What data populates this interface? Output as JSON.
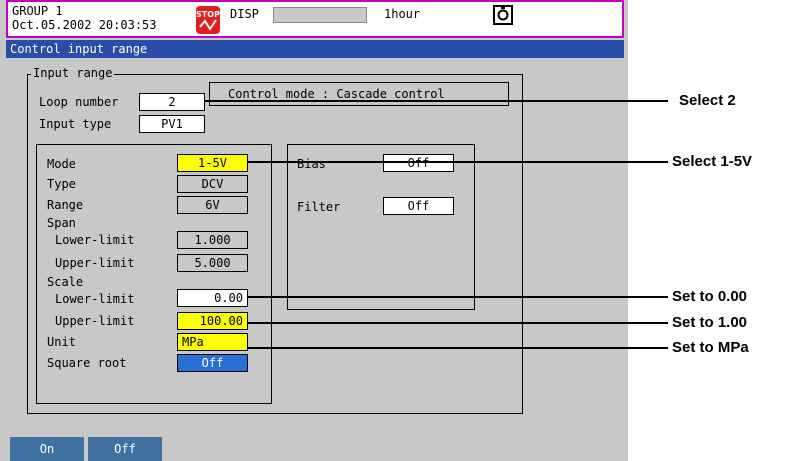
{
  "status": {
    "group": "GROUP 1",
    "datetime": "Oct.05.2002 20:03:53",
    "stop_icon": "stop-icon",
    "disp": "DISP",
    "interval": "1hour",
    "disk_icon": "disk-icon",
    "border_color": "#c000c0"
  },
  "title": "Control input range",
  "input_range": {
    "legend": "Input range",
    "loop_label": "Loop number",
    "loop_value": "2",
    "type_label": "Input type",
    "type_value": "PV1",
    "control_mode": "Control mode : Cascade control"
  },
  "settings": {
    "mode_label": "Mode",
    "mode_value": "1-5V",
    "type_label": "Type",
    "type_value": "DCV",
    "range_label": "Range",
    "range_value": "6V",
    "span_label": "Span",
    "span_lower_label": "Lower-limit",
    "span_lower_value": "1.000",
    "span_upper_label": "Upper-limit",
    "span_upper_value": "5.000",
    "scale_label": "Scale",
    "scale_lower_label": "Lower-limit",
    "scale_lower_value": "0.00",
    "scale_upper_label": "Upper-limit",
    "scale_upper_value": "100.00",
    "unit_label": "Unit",
    "unit_value": "MPa",
    "sqrt_label": "Square root",
    "sqrt_value": "Off",
    "bias_label": "Bias",
    "bias_value": "Off",
    "filter_label": "Filter",
    "filter_value": "Off"
  },
  "softkeys": {
    "on": "On",
    "off": "Off"
  },
  "annotations": {
    "a1": "Select 2",
    "a2": "Select 1-5V",
    "a3": "Set to 0.00",
    "a4": "Set to 1.00",
    "a5": "Set to MPa"
  },
  "colors": {
    "title_bar": "#2a4da8",
    "highlight": "#ffff00",
    "selected": "#2a6fd6"
  }
}
